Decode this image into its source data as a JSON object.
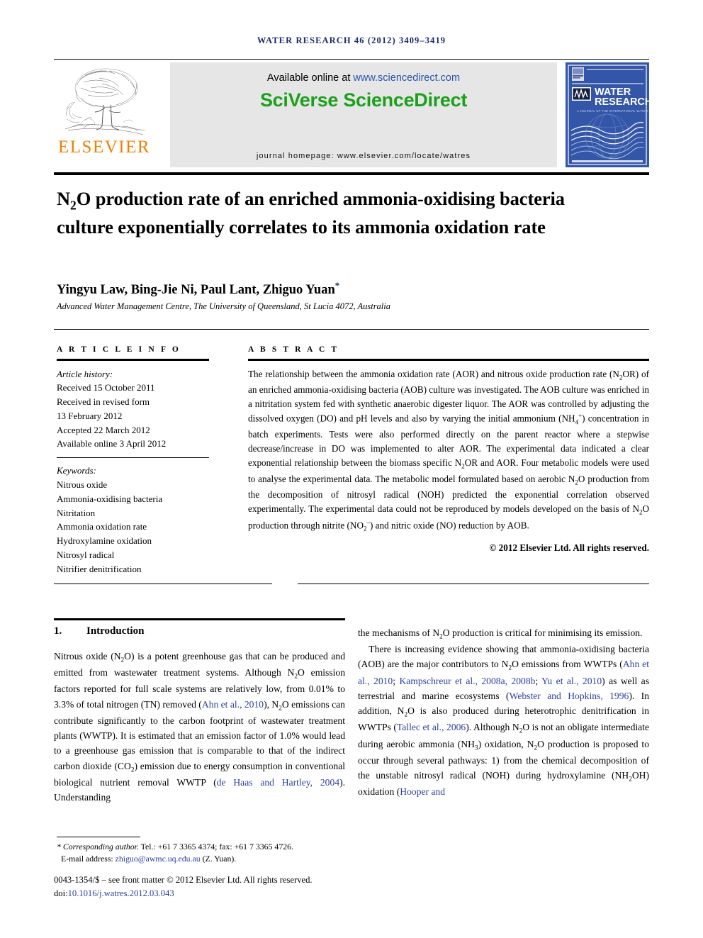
{
  "running_head": "WATER RESEARCH 46 (2012) 3409–3419",
  "masthead": {
    "publisher_name": "ELSEVIER",
    "publisher_logo_alt": "elsevier-tree-logo",
    "available_online_prefix": "Available online at ",
    "available_online_url": "www.sciencedirect.com",
    "sciencedirect_logo": "SciVerse ScienceDirect",
    "journal_homepage": "journal homepage: www.elsevier.com/locate/watres",
    "cover": {
      "title_line1": "WATER",
      "title_line2": "RESEARCH",
      "society_logo": "IWA",
      "tagline": "A JOURNAL OF THE INTERNATIONAL WATER ASSOCIATION"
    }
  },
  "article": {
    "title": "N₂O production rate of an enriched ammonia-oxidising bacteria culture exponentially correlates to its ammonia oxidation rate",
    "authors": "Yingyu Law, Bing-Jie Ni, Paul Lant, Zhiguo Yuan",
    "corresponding_marker": "*",
    "affiliation": "Advanced Water Management Centre, The University of Queensland, St Lucia 4072, Australia"
  },
  "article_info": {
    "heading": "A R T I C L E  I N F O",
    "history_label": "Article history:",
    "history": [
      "Received 15 October 2011",
      "Received in revised form",
      "13 February 2012",
      "Accepted 22 March 2012",
      "Available online 3 April 2012"
    ],
    "keywords_label": "Keywords:",
    "keywords": [
      "Nitrous oxide",
      "Ammonia-oxidising bacteria",
      "Nitritation",
      "Ammonia oxidation rate",
      "Hydroxylamine oxidation",
      "Nitrosyl radical",
      "Nitrifier denitrification"
    ]
  },
  "abstract": {
    "heading": "A B S T R A C T",
    "copyright": "© 2012 Elsevier Ltd. All rights reserved."
  },
  "introduction": {
    "number": "1.",
    "heading": "Introduction"
  },
  "footnote": {
    "star": "*",
    "corresponding_label": "Corresponding author.",
    "tel_fax": " Tel.: +61 7 3365 4374; fax: +61 7 3365 4726.",
    "email_label": "E-mail address: ",
    "email": "zhiguo@awmc.uq.edu.au",
    "email_suffix": " (Z. Yuan).",
    "issn_line": "0043-1354/$ – see front matter © 2012 Elsevier Ltd. All rights reserved.",
    "doi_prefix": "doi:",
    "doi": "10.1016/j.watres.2012.03.043"
  },
  "colors": {
    "running_head": "#1a2a6c",
    "elsevier_orange": "#f08000",
    "sciencedirect_green": "#1ca01c",
    "link_blue": "#2b55a8",
    "citation_blue": "#2b3f9e",
    "cover_blue": "#3456a8",
    "panel_grey": "#e6e6e6"
  }
}
